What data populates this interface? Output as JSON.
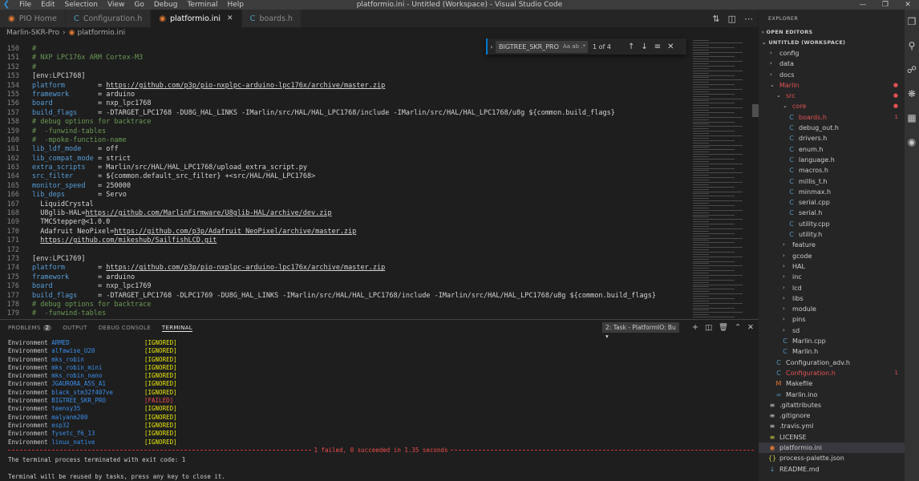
{
  "window": {
    "menu": [
      "File",
      "Edit",
      "Selection",
      "View",
      "Go",
      "Debug",
      "Terminal",
      "Help"
    ],
    "title": "platformio.ini - Untitled (Workspace) - Visual Studio Code"
  },
  "tabs": [
    {
      "label": "PIO Home",
      "icon": "platformio-icon"
    },
    {
      "label": "Configuration.h",
      "icon": "c-header-icon"
    },
    {
      "label": "platformio.ini",
      "icon": "platformio-icon",
      "active": true
    },
    {
      "label": "boards.h",
      "icon": "c-header-icon"
    }
  ],
  "breadcrumb": {
    "folder": "Marlin-SKR-Pro",
    "file": "platformio.ini"
  },
  "find": {
    "query": "BIGTREE_SKR_PRO",
    "count": "1 of 4",
    "options": "Aa ab .*"
  },
  "code_lines": [
    {
      "n": "150",
      "t": "#",
      "k": "comment"
    },
    {
      "n": "151",
      "t": "# NXP LPC176x ARM Cortex-M3",
      "k": "comment"
    },
    {
      "n": "152",
      "t": "#",
      "k": "comment"
    },
    {
      "n": "153",
      "t": "[env:LPC1768]",
      "k": "section"
    },
    {
      "n": "154",
      "key": "platform",
      "val": "https://github.com/p3p/pio-nxplpc-arduino-lpc176x/archive/master.zip",
      "k": "kvlink"
    },
    {
      "n": "155",
      "key": "framework",
      "val": "arduino",
      "k": "kv"
    },
    {
      "n": "156",
      "key": "board",
      "val": "nxp_lpc1768",
      "k": "kv"
    },
    {
      "n": "157",
      "key": "build_flags",
      "val": "-DTARGET_LPC1768 -DU8G_HAL_LINKS -IMarlin/src/HAL/HAL_LPC1768/include -IMarlin/src/HAL/HAL_LPC1768/u8g ${common.build_flags}",
      "k": "kv"
    },
    {
      "n": "158",
      "t": "# debug options for backtrace",
      "k": "comment"
    },
    {
      "n": "159",
      "t": "#  -funwind-tables",
      "k": "comment"
    },
    {
      "n": "160",
      "t": "#  -mpoke-function-name",
      "k": "comment"
    },
    {
      "n": "161",
      "key": "lib_ldf_mode",
      "val": "off",
      "k": "kv"
    },
    {
      "n": "162",
      "key": "lib_compat_mode",
      "val": "strict",
      "k": "kv"
    },
    {
      "n": "163",
      "key": "extra_scripts",
      "val": "Marlin/src/HAL/HAL_LPC1768/upload_extra_script.py",
      "k": "kv"
    },
    {
      "n": "164",
      "key": "src_filter",
      "val": "${common.default_src_filter} +<src/HAL/HAL_LPC1768>",
      "k": "kv"
    },
    {
      "n": "165",
      "key": "monitor_speed",
      "val": "250000",
      "k": "kv"
    },
    {
      "n": "166",
      "key": "lib_deps",
      "val": "Servo",
      "k": "kv"
    },
    {
      "n": "167",
      "t": "  LiquidCrystal",
      "k": "plain"
    },
    {
      "n": "168",
      "pre": "  U8glib-HAL=",
      "val": "https://github.com/MarlinFirmware/U8glib-HAL/archive/dev.zip",
      "k": "link"
    },
    {
      "n": "169",
      "t": "  TMCStepper@<1.0.0",
      "k": "plain"
    },
    {
      "n": "170",
      "pre": "  Adafruit NeoPixel=",
      "val": "https://github.com/p3p/Adafruit_NeoPixel/archive/master.zip",
      "k": "link"
    },
    {
      "n": "171",
      "pre": "  ",
      "val": "https://github.com/mikeshub/SailfishLCD.git",
      "k": "link"
    },
    {
      "n": "172",
      "t": "",
      "k": "plain"
    },
    {
      "n": "173",
      "t": "[env:LPC1769]",
      "k": "section"
    },
    {
      "n": "174",
      "key": "platform",
      "val": "https://github.com/p3p/pio-nxplpc-arduino-lpc176x/archive/master.zip",
      "k": "kvlink"
    },
    {
      "n": "175",
      "key": "framework",
      "val": "arduino",
      "k": "kv"
    },
    {
      "n": "176",
      "key": "board",
      "val": "nxp_lpc1769",
      "k": "kv"
    },
    {
      "n": "177",
      "key": "build_flags",
      "val": "-DTARGET_LPC1768 -DLPC1769 -DU8G_HAL_LINKS -IMarlin/src/HAL/HAL_LPC1768/include -IMarlin/src/HAL/HAL_LPC1768/u8g ${common.build_flags}",
      "k": "kv"
    },
    {
      "n": "178",
      "t": "# debug options for backtrace",
      "k": "comment"
    },
    {
      "n": "179",
      "t": "#  -funwind-tables",
      "k": "comment"
    }
  ],
  "panel": {
    "tabs": [
      "PROBLEMS",
      "OUTPUT",
      "DEBUG CONSOLE",
      "TERMINAL"
    ],
    "problems_count": "2",
    "task_select": "2: Task - PlatformIO: Bu"
  },
  "terminal": {
    "rows": [
      {
        "label": "Environment",
        "name": "ARMED",
        "status": "[IGNORED]"
      },
      {
        "label": "Environment",
        "name": "alfawise_U20",
        "status": "[IGNORED]"
      },
      {
        "label": "Environment",
        "name": "mks_robin",
        "status": "[IGNORED]"
      },
      {
        "label": "Environment",
        "name": "mks_robin_mini",
        "status": "[IGNORED]"
      },
      {
        "label": "Environment",
        "name": "mks_robin_nano",
        "status": "[IGNORED]"
      },
      {
        "label": "Environment",
        "name": "JGAURORA_A5S_A1",
        "status": "[IGNORED]"
      },
      {
        "label": "Environment",
        "name": "black_stm32f407ve",
        "status": "[IGNORED]"
      },
      {
        "label": "Environment",
        "name": "BIGTREE_SKR_PRO",
        "status": "[FAILED]",
        "failed": true
      },
      {
        "label": "Environment",
        "name": "teensy35",
        "status": "[IGNORED]"
      },
      {
        "label": "Environment",
        "name": "malyanm200",
        "status": "[IGNORED]"
      },
      {
        "label": "Environment",
        "name": "esp32",
        "status": "[IGNORED]"
      },
      {
        "label": "Environment",
        "name": "fysetc_f6_13",
        "status": "[IGNORED]"
      },
      {
        "label": "Environment",
        "name": "linux_native",
        "status": "[IGNORED]"
      }
    ],
    "summary": "1 failed, 0 succeeded in 1.35 seconds",
    "exit_msg": "The terminal process terminated with exit code: 1",
    "reuse_msg": "Terminal will be reused by tasks, press any key to close it."
  },
  "explorer": {
    "title": "EXPLORER",
    "open_editors": "OPEN EDITORS",
    "workspace": "UNTITLED (WORKSPACE)",
    "items": [
      {
        "name": "config",
        "type": "folder",
        "depth": 1
      },
      {
        "name": "data",
        "type": "folder",
        "depth": 1
      },
      {
        "name": "docs",
        "type": "folder",
        "depth": 1
      },
      {
        "name": "Marlin",
        "type": "folder-open",
        "depth": 1,
        "modified": true
      },
      {
        "name": "src",
        "type": "folder-open",
        "depth": 2,
        "modified": true
      },
      {
        "name": "core",
        "type": "folder-open",
        "depth": 3,
        "modified": true
      },
      {
        "name": "boards.h",
        "type": "c",
        "depth": 4,
        "modified": true,
        "badge": "1"
      },
      {
        "name": "debug_out.h",
        "type": "c",
        "depth": 4
      },
      {
        "name": "drivers.h",
        "type": "c",
        "depth": 4
      },
      {
        "name": "enum.h",
        "type": "c",
        "depth": 4
      },
      {
        "name": "language.h",
        "type": "c",
        "depth": 4
      },
      {
        "name": "macros.h",
        "type": "c",
        "depth": 4
      },
      {
        "name": "millis_t.h",
        "type": "c",
        "depth": 4
      },
      {
        "name": "minmax.h",
        "type": "c",
        "depth": 4
      },
      {
        "name": "serial.cpp",
        "type": "cpp",
        "depth": 4
      },
      {
        "name": "serial.h",
        "type": "c",
        "depth": 4
      },
      {
        "name": "utility.cpp",
        "type": "cpp",
        "depth": 4
      },
      {
        "name": "utility.h",
        "type": "c",
        "depth": 4
      },
      {
        "name": "feature",
        "type": "folder",
        "depth": 3
      },
      {
        "name": "gcode",
        "type": "folder",
        "depth": 3
      },
      {
        "name": "HAL",
        "type": "folder",
        "depth": 3
      },
      {
        "name": "inc",
        "type": "folder",
        "depth": 3
      },
      {
        "name": "lcd",
        "type": "folder",
        "depth": 3
      },
      {
        "name": "libs",
        "type": "folder",
        "depth": 3
      },
      {
        "name": "module",
        "type": "folder",
        "depth": 3
      },
      {
        "name": "pins",
        "type": "folder",
        "depth": 3
      },
      {
        "name": "sd",
        "type": "folder",
        "depth": 3
      },
      {
        "name": "Marlin.cpp",
        "type": "cpp",
        "depth": 3
      },
      {
        "name": "Marlin.h",
        "type": "c",
        "depth": 3
      },
      {
        "name": "Configuration_adv.h",
        "type": "c",
        "depth": 2
      },
      {
        "name": "Configuration.h",
        "type": "c",
        "depth": 2,
        "modified": true,
        "badge": "1"
      },
      {
        "name": "Makefile",
        "type": "make",
        "depth": 2
      },
      {
        "name": "Marlin.ino",
        "type": "ino",
        "depth": 2
      },
      {
        "name": ".gitattributes",
        "type": "txt",
        "depth": 1
      },
      {
        "name": ".gitignore",
        "type": "txt",
        "depth": 1
      },
      {
        "name": ".travis.yml",
        "type": "txt",
        "depth": 1
      },
      {
        "name": "LICENSE",
        "type": "license",
        "depth": 1
      },
      {
        "name": "platformio.ini",
        "type": "pio",
        "depth": 1,
        "selected": true
      },
      {
        "name": "process-palette.json",
        "type": "json",
        "depth": 1
      },
      {
        "name": "README.md",
        "type": "md",
        "depth": 1
      }
    ]
  }
}
